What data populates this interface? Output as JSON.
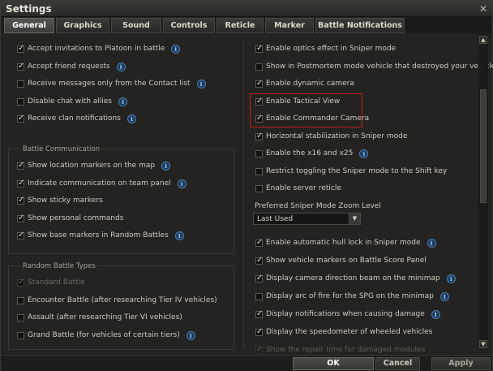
{
  "window": {
    "title": "Settings",
    "close_glyph": "✕"
  },
  "tabs": [
    {
      "label": "General",
      "active": true
    },
    {
      "label": "Graphics"
    },
    {
      "label": "Sound"
    },
    {
      "label": "Controls"
    },
    {
      "label": "Reticle"
    },
    {
      "label": "Marker"
    },
    {
      "label": "Battle Notifications"
    }
  ],
  "left": {
    "general_options": [
      {
        "label": "Accept invitations to Platoon in battle",
        "checked": true,
        "info": true
      },
      {
        "label": "Accept friend requests",
        "checked": true,
        "info": true
      },
      {
        "label": "Receive messages only from the Contact list",
        "checked": false,
        "info": true
      },
      {
        "label": "Disable chat with allies",
        "checked": false,
        "info": true
      },
      {
        "label": "Receive clan notifications",
        "checked": true,
        "info": true
      }
    ],
    "battle_communication": {
      "title": "Battle Communication",
      "options": [
        {
          "label": "Show location markers on the map",
          "checked": true,
          "info": true
        },
        {
          "label": "Indicate communication on team panel",
          "checked": true,
          "info": true
        },
        {
          "label": "Show sticky markers",
          "checked": true,
          "info": false
        },
        {
          "label": "Show personal commands",
          "checked": true,
          "info": false
        },
        {
          "label": "Show base markers in Random Battles",
          "checked": true,
          "info": true
        }
      ]
    },
    "random_battle_types": {
      "title": "Random Battle Types",
      "options": [
        {
          "label": "Standard Battle",
          "checked": true,
          "disabled": true
        },
        {
          "label": "Encounter Battle (after researching Tier IV vehicles)",
          "checked": false
        },
        {
          "label": "Assault (after researching Tier VI vehicles)",
          "checked": false
        },
        {
          "label": "Grand Battle (for vehicles of certain tiers)",
          "checked": false,
          "info": true
        }
      ]
    }
  },
  "right": {
    "options_top": [
      {
        "label": "Enable optics effect in Sniper mode",
        "checked": true
      },
      {
        "label": "Show in Postmortem mode vehicle that destroyed your vehicle",
        "checked": false
      },
      {
        "label": "Enable dynamic camera",
        "checked": true
      },
      {
        "label": "Enable Tactical View",
        "checked": true
      },
      {
        "label": "Enable Commander Camera",
        "checked": true
      },
      {
        "label": "Horizontal stabilization in Sniper mode",
        "checked": true
      },
      {
        "label": "Enable the x16 and x25",
        "checked": false,
        "info": true
      },
      {
        "label": "Restrict toggling the Sniper mode to the Shift key",
        "checked": false
      },
      {
        "label": "Enable server reticle",
        "checked": false
      }
    ],
    "zoom_level": {
      "label": "Preferred Sniper Mode Zoom Level",
      "selected": "Last Used",
      "arrow_glyph": "▼"
    },
    "options_bottom": [
      {
        "label": "Enable automatic hull lock in Sniper mode",
        "checked": true,
        "info": true
      },
      {
        "label": "Show vehicle markers on Battle Score Panel",
        "checked": true
      },
      {
        "label": "Display camera direction beam on the minimap",
        "checked": true,
        "info": true
      },
      {
        "label": "Display arc of fire for the SPG on the minimap",
        "checked": false,
        "info": true
      },
      {
        "label": "Display notifications when causing damage",
        "checked": true,
        "info": true
      },
      {
        "label": "Display the speedometer of wheeled vehicles",
        "checked": true
      },
      {
        "label": "Show the repair time for damaged modules",
        "checked": true
      }
    ]
  },
  "scrollbar": {
    "up_glyph": "▲",
    "down_glyph": "▼"
  },
  "footer": {
    "ok": "OK",
    "cancel": "Cancel",
    "apply": "Apply"
  },
  "info_glyph": "i",
  "colors": {
    "highlight": "#c01e1e",
    "info_icon": "#4a7fb5"
  }
}
